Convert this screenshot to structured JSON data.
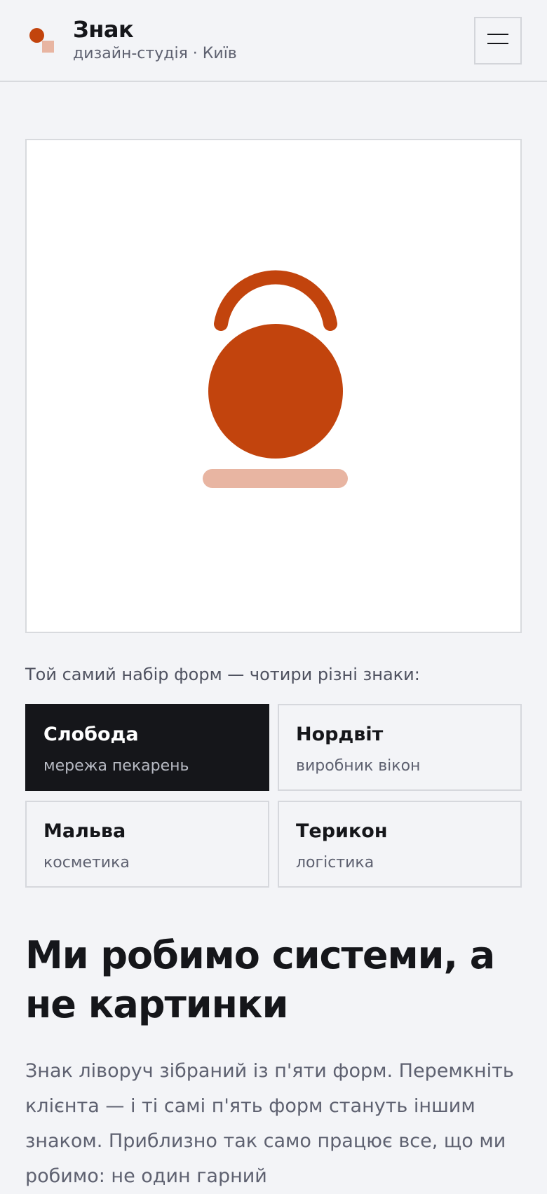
{
  "header": {
    "brand_name": "Знак",
    "brand_subtitle": "дизайн-студія · Київ",
    "menu_icon": "hamburger-icon"
  },
  "hero": {
    "illustration": "kettlebell-mark",
    "colors": {
      "primary": "#c2440d",
      "secondary": "#e8b5a2"
    }
  },
  "selector": {
    "caption": "Той самий набір форм — чотири різні знаки:",
    "clients": [
      {
        "name": "Слобода",
        "description": "мережа пекарень",
        "active": true
      },
      {
        "name": "Нордвіт",
        "description": "виробник вікон",
        "active": false
      },
      {
        "name": "Мальва",
        "description": "косметика",
        "active": false
      },
      {
        "name": "Терикон",
        "description": "логістика",
        "active": false
      }
    ]
  },
  "intro": {
    "headline": "Ми робимо системи, а не картинки",
    "body": "Знак ліворуч зібраний із п'яти форм. Перемкніть клієнта — і ті самі п'ять форм стануть іншим знаком. Приблизно так само працює все, що ми робимо: не один гарний"
  },
  "colors": {
    "accent": "#c2440d",
    "accent_light": "#e8b5a2",
    "ink": "#15161a",
    "muted": "#5e6170",
    "background": "#f3f4f7"
  }
}
